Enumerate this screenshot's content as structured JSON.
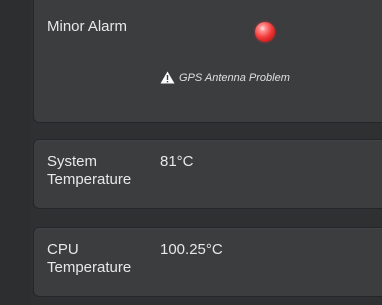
{
  "alarm": {
    "label": "Minor Alarm",
    "led_color": "#f23a3a",
    "warning_icon": "warning-triangle-icon",
    "warning_text": "GPS Antenna Problem"
  },
  "system_temperature": {
    "label_line1": "System",
    "label_line2": "Temperature",
    "value": "81°C"
  },
  "cpu_temperature": {
    "label_line1": "CPU",
    "label_line2": "Temperature",
    "value": "100.25°C"
  }
}
